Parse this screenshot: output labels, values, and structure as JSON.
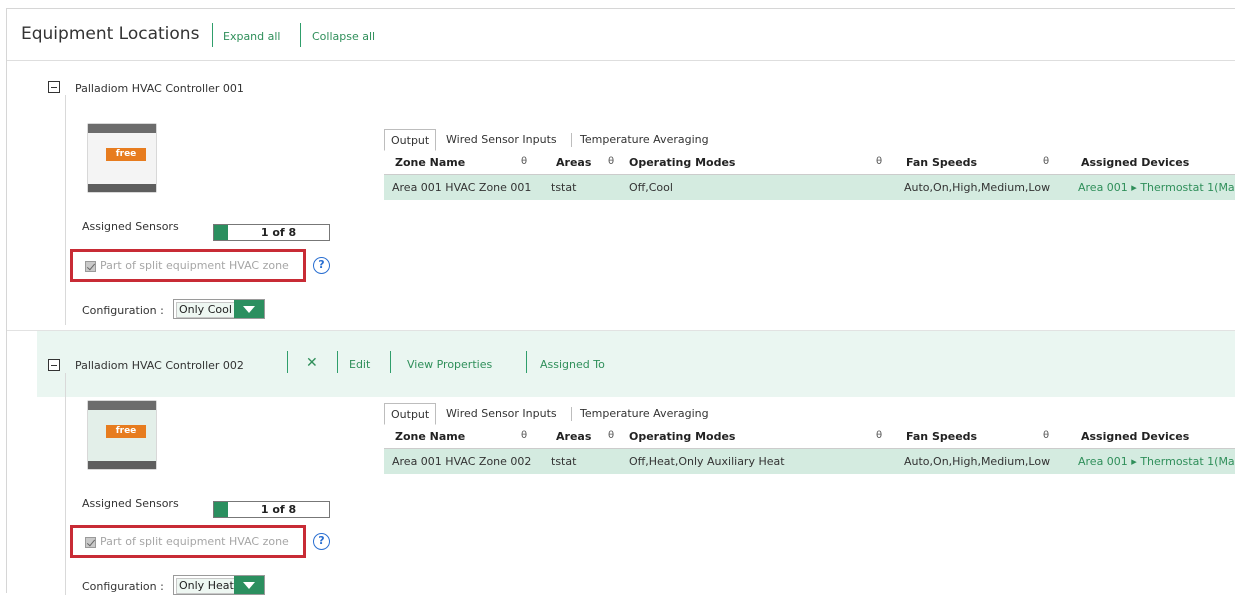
{
  "header": {
    "title": "Equipment Locations",
    "expand_all": "Expand all",
    "collapse_all": "Collapse all"
  },
  "colors": {
    "accent": "#2b8f5f",
    "highlight_box": "#c82b35",
    "row_bg": "#d4ebe0"
  },
  "grid_columns": {
    "zone_name": "Zone Name",
    "areas": "Areas",
    "operating_modes": "Operating Modes",
    "fan_speeds": "Fan Speeds",
    "assigned_devices": "Assigned Devices",
    "sort_icon": "θ"
  },
  "tabs": {
    "output": "Output",
    "wired": "Wired Sensor Inputs",
    "averaging": "Temperature Averaging"
  },
  "controllers": [
    {
      "name": "Palladiom HVAC Controller 001",
      "device_logo": "free",
      "assigned_sensors_label": "Assigned Sensors",
      "assigned_sensors_value": "1 of 8",
      "assigned_fraction": 0.125,
      "split_label": "Part of split equipment HVAC zone",
      "config_label": "Configuration :",
      "config_value": "Only Cool",
      "row": {
        "zone_name": "Area 001 HVAC Zone 001",
        "areas": "tstat",
        "operating_modes": "Off,Cool",
        "fan_speeds": "Auto,On,High,Medium,Low",
        "assigned_devices": "Area 001 ▸ Thermostat 1(Ma"
      }
    },
    {
      "name": "Palladiom HVAC Controller 002",
      "device_logo": "free",
      "actions": {
        "delete": "✕",
        "edit": "Edit",
        "view_properties": "View Properties",
        "assigned_to": "Assigned To"
      },
      "assigned_sensors_label": "Assigned Sensors",
      "assigned_sensors_value": "1 of 8",
      "assigned_fraction": 0.125,
      "split_label": "Part of split equipment HVAC zone",
      "config_label": "Configuration :",
      "config_value": "Only Heat",
      "row": {
        "zone_name": "Area 001 HVAC Zone 002",
        "areas": "tstat",
        "operating_modes": "Off,Heat,Only Auxiliary Heat",
        "fan_speeds": "Auto,On,High,Medium,Low",
        "assigned_devices": "Area 001 ▸ Thermostat 1(Ma"
      }
    }
  ]
}
